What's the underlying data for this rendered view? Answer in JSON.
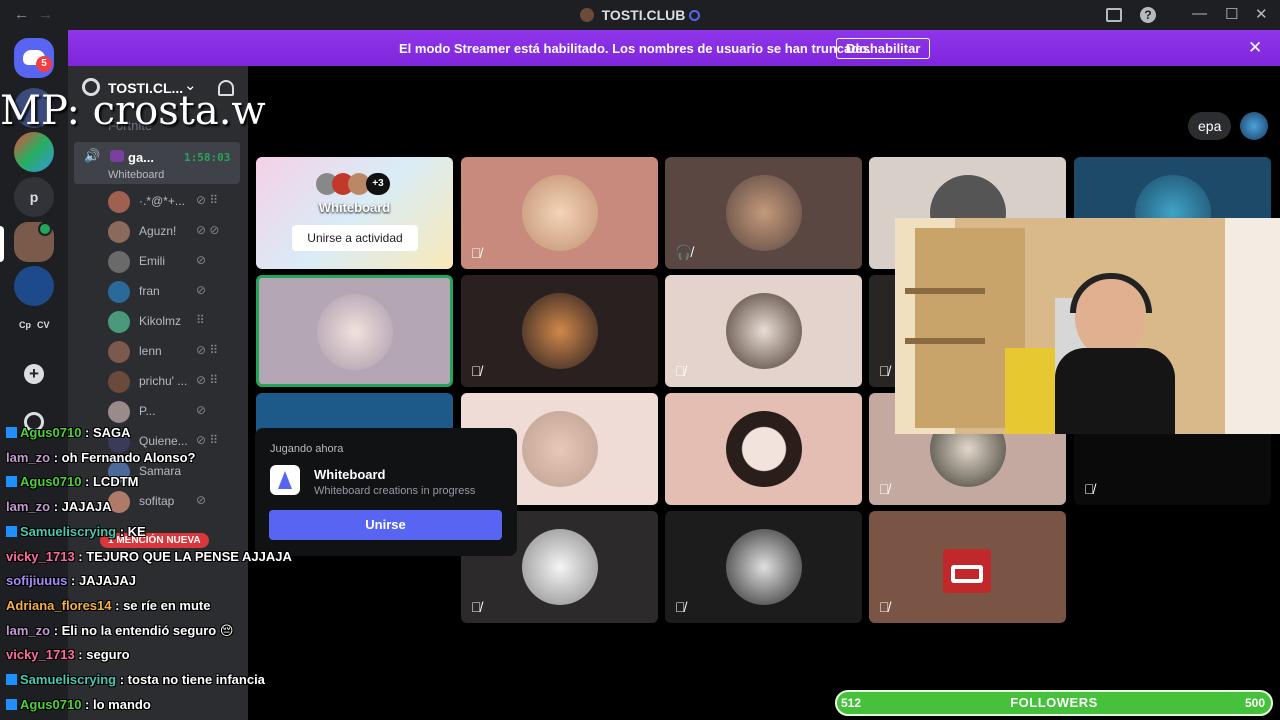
{
  "titlebar": {
    "back": "←",
    "forward": "→",
    "title": "TOSTI.CLUB",
    "minimize": "—",
    "maximize": "☐",
    "close": "✕",
    "help": "?"
  },
  "banner": {
    "text": "El modo Streamer está habilitado. Los nombres de usuario se han truncado.",
    "button": "Deshabilitar",
    "close": "✕"
  },
  "servers": {
    "dm_badge": "5",
    "p_label": "p",
    "cp_label": "Cp",
    "cv_label": "CV",
    "add": "+"
  },
  "channel_header": {
    "name": "TOSTI.CL...",
    "chevron": "⌄",
    "subchannel": "Fortnite"
  },
  "voice_channel": {
    "name": "ga...",
    "timer": "1:58:03",
    "activity": "Whiteboard"
  },
  "members": [
    {
      "name": "·.*@*+...",
      "icons": "⊘ ⠿"
    },
    {
      "name": "Aguzn!",
      "icons": "⊘ ⊘"
    },
    {
      "name": "Emili",
      "icons": "⊘"
    },
    {
      "name": "fran",
      "icons": "⊘"
    },
    {
      "name": "Kikolmz",
      "icons": "⠿"
    },
    {
      "name": "lenn",
      "icons": "⊘ ⠿"
    },
    {
      "name": "prichu' ...",
      "icons": "⊘ ⠿"
    },
    {
      "name": "P...",
      "icons": "⊘"
    },
    {
      "name": "Quiene...",
      "icons": "⊘ ⠿"
    },
    {
      "name": "Samara",
      "icons": ""
    },
    {
      "name": "sofitap",
      "icons": "⊘"
    }
  ],
  "mention_badge": "1 MENCIÓN NUEVA",
  "overlay_text": "MP: crosta.w",
  "top_right": {
    "button": "epa"
  },
  "whiteboard_tile": {
    "count": "+3",
    "title": "Whiteboard",
    "button": "Unirse a actividad"
  },
  "popup": {
    "heading": "Jugando ahora",
    "app": "Whiteboard",
    "desc": "Whiteboard creations in progress",
    "button": "Unirse"
  },
  "chat": [
    {
      "user": "Agus0710",
      "msg": "SAGA",
      "color": "#4cd137",
      "sub": true
    },
    {
      "user": "lam_zo",
      "msg": "oh Fernando Alonso?",
      "color": "#c39bd3",
      "sub": false
    },
    {
      "user": "Agus0710",
      "msg": "LCDTM",
      "color": "#4cd137",
      "sub": true
    },
    {
      "user": "lam_zo",
      "msg": "JAJAJA",
      "color": "#c39bd3",
      "sub": false
    },
    {
      "user": "Samueliscrying",
      "msg": "KE",
      "color": "#48c9b0",
      "sub": true
    },
    {
      "user": "vicky_1713",
      "msg": "TEJURO QUE LA PENSE AJJAJA",
      "color": "#ff6b9d",
      "sub": false
    },
    {
      "user": "sofijiuuus",
      "msg": "JAJAJAJ",
      "color": "#a78bfa",
      "sub": false
    },
    {
      "user": "Adriana_flores14",
      "msg": "se ríe en mute",
      "color": "#f5b041",
      "sub": false
    },
    {
      "user": "lam_zo",
      "msg": "Eli no la entendió seguro 😔",
      "color": "#c39bd3",
      "sub": false
    },
    {
      "user": "vicky_1713",
      "msg": "seguro",
      "color": "#ff6b9d",
      "sub": false
    },
    {
      "user": "Samueliscrying",
      "msg": "tosta no tiene infancia",
      "color": "#48c9b0",
      "sub": true
    },
    {
      "user": "Agus0710",
      "msg": "lo mando",
      "color": "#4cd137",
      "sub": true
    }
  ],
  "followers": {
    "current": "512",
    "label": "FOLLOWERS",
    "goal": "500"
  },
  "colors": {
    "banner": "#8f35ea",
    "followers_bar": "#45c13b",
    "popup_button": "#5865f2"
  }
}
